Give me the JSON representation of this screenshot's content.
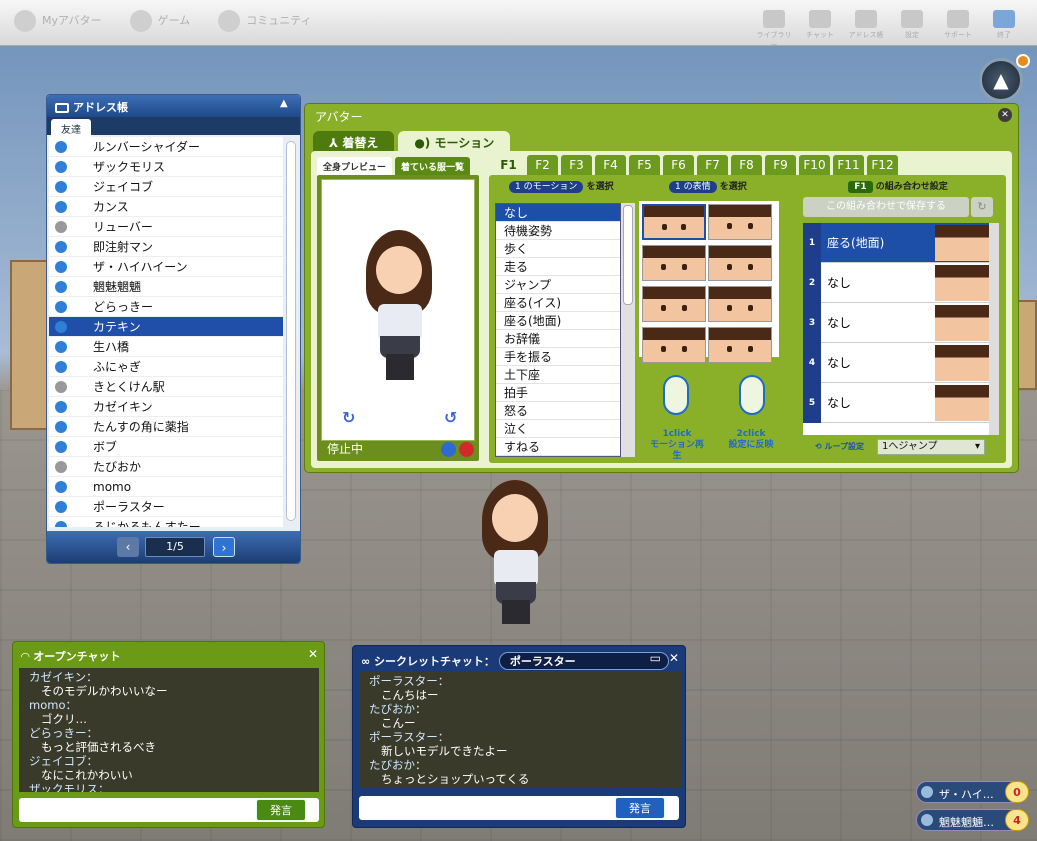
{
  "topbar": {
    "left": [
      {
        "label": "Myアバター"
      },
      {
        "label": "ゲーム"
      },
      {
        "label": "コミュニティ"
      }
    ],
    "right": [
      {
        "label": "ライブラリー"
      },
      {
        "label": "チャット"
      },
      {
        "label": "アドレス帳"
      },
      {
        "label": "設定"
      },
      {
        "label": "サポート"
      },
      {
        "label": "終了"
      }
    ]
  },
  "address_book": {
    "title": "アドレス帳",
    "tab": "友達",
    "page": "1/5",
    "friends": [
      {
        "name": "ルンバーシャイダー",
        "online": true
      },
      {
        "name": "ザックモリス",
        "online": true
      },
      {
        "name": "ジェイコブ",
        "online": true
      },
      {
        "name": "カンス",
        "online": true
      },
      {
        "name": "リューバー",
        "online": false
      },
      {
        "name": "即注射マン",
        "online": true
      },
      {
        "name": "ザ・ハイハイーン",
        "online": true
      },
      {
        "name": "魍魅魍魎",
        "online": true
      },
      {
        "name": "どらっきー",
        "online": true
      },
      {
        "name": "カテキン",
        "online": true,
        "selected": true
      },
      {
        "name": "生ハ橋",
        "online": true
      },
      {
        "name": "ふにゃぎ",
        "online": true
      },
      {
        "name": "きとくけん駅",
        "online": false
      },
      {
        "name": "カゼイキン",
        "online": true
      },
      {
        "name": "たんすの角に薬指",
        "online": true
      },
      {
        "name": "ボブ",
        "online": true
      },
      {
        "name": "たびおか",
        "online": false
      },
      {
        "name": "momo",
        "online": true
      },
      {
        "name": "ポーラスター",
        "online": true
      },
      {
        "name": "ろじかるもんすたー",
        "online": true
      }
    ]
  },
  "avatar_window": {
    "title": "アバター",
    "tabs": [
      "着替え",
      "モーション"
    ],
    "active_tab": "モーション",
    "preview_tabs": [
      "全身プレビュー",
      "着ている服一覧"
    ],
    "status": "停止中",
    "ftabs": [
      "F1",
      "F2",
      "F3",
      "F4",
      "F5",
      "F6",
      "F7",
      "F8",
      "F9",
      "F10",
      "F11",
      "F12"
    ],
    "motion_header": {
      "step": "1 のモーション",
      "suffix": "を選択"
    },
    "face_header": {
      "step": "1 の表情",
      "suffix": "を選択"
    },
    "motions": [
      "なし",
      "待機姿勢",
      "歩く",
      "走る",
      "ジャンプ",
      "座る(イス)",
      "座る(地面)",
      "お辞儀",
      "手を振る",
      "土下座",
      "拍手",
      "怒る",
      "泣く",
      "すねる"
    ],
    "selected_motion": "なし",
    "click1": [
      "1click",
      "モーション再生"
    ],
    "click2": [
      "2click",
      "設定に反映"
    ],
    "combo_header": {
      "key": "F1",
      "suffix": "の組み合わせ設定"
    },
    "save_label": "この組み合わせで保存する",
    "slots": [
      {
        "n": "1",
        "label": "座る(地面)"
      },
      {
        "n": "2",
        "label": "なし"
      },
      {
        "n": "3",
        "label": "なし"
      },
      {
        "n": "4",
        "label": "なし"
      },
      {
        "n": "5",
        "label": "なし"
      }
    ],
    "loop_label": "ループ設定",
    "loop_value": "1へジャンプ"
  },
  "open_chat": {
    "title": "オープンチャット",
    "send": "発言",
    "lines": [
      {
        "name": "カゼイキン：",
        "msg": "そのモデルかわいいなー"
      },
      {
        "name": "momo：",
        "msg": "ゴクリ…"
      },
      {
        "name": "どらっきー：",
        "msg": "もっと評価されるべき"
      },
      {
        "name": "ジェイコブ：",
        "msg": "なにこれかわいい"
      },
      {
        "name": "ザックモリス：",
        "msg": ""
      }
    ]
  },
  "secret_chat": {
    "title": "シークレットチャット：",
    "partner": "ポーラスター",
    "send": "発言",
    "lines": [
      {
        "name": "ポーラスター：",
        "msg": "こんちはー"
      },
      {
        "name": "たびおか：",
        "msg": "こんー"
      },
      {
        "name": "ポーラスター：",
        "msg": "新しいモデルできたよー"
      },
      {
        "name": "たびおか：",
        "msg": "ちょっとショップいってくる"
      }
    ]
  },
  "notifications": [
    {
      "name": "ザ・ハイ…",
      "count": "0"
    },
    {
      "name": "魍魅魍魎…",
      "count": "4"
    }
  ],
  "colors": {
    "accent_green": "#8ab02a",
    "accent_blue": "#1e4fa8"
  }
}
